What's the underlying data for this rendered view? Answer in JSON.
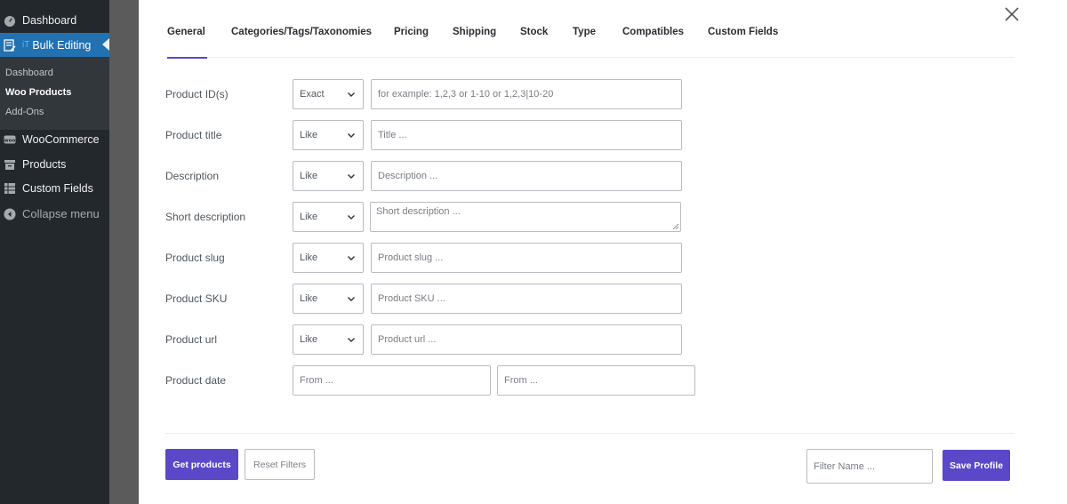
{
  "sidebar": {
    "dashboard": "Dashboard",
    "bulk_editing_prefix": "iT",
    "bulk_editing": "Bulk Editing",
    "submenu": [
      "Dashboard",
      "Woo Products",
      "Add-Ons"
    ],
    "woocommerce": "WooCommerce",
    "products": "Products",
    "custom_fields": "Custom Fields",
    "collapse": "Collapse menu"
  },
  "tabs": [
    "General",
    "Categories/Tags/Taxonomies",
    "Pricing",
    "Shipping",
    "Stock",
    "Type",
    "Compatibles",
    "Custom Fields"
  ],
  "active_tab": "General",
  "form": {
    "rows": [
      {
        "label": "Product ID(s)",
        "operator": "Exact",
        "placeholder": "for example: 1,2,3 or 1-10 or 1,2,3|10-20"
      },
      {
        "label": "Product title",
        "operator": "Like",
        "placeholder": "Title ..."
      },
      {
        "label": "Description",
        "operator": "Like",
        "placeholder": "Description ..."
      },
      {
        "label": "Short description",
        "operator": "Like",
        "placeholder": "Short description ..."
      },
      {
        "label": "Product slug",
        "operator": "Like",
        "placeholder": "Product slug ..."
      },
      {
        "label": "Product SKU",
        "operator": "Like",
        "placeholder": "Product SKU ..."
      },
      {
        "label": "Product url",
        "operator": "Like",
        "placeholder": "Product url ..."
      }
    ],
    "date": {
      "label": "Product date",
      "from_placeholder": "From ...",
      "to_placeholder": "From ..."
    }
  },
  "footer": {
    "get_products": "Get products",
    "reset_filters": "Reset Filters",
    "filter_name_placeholder": "Filter Name ...",
    "save_profile": "Save Profile"
  },
  "colors": {
    "accent": "#5a48c8",
    "sidebar_bg": "#23282d",
    "wp_blue": "#2271b1"
  }
}
